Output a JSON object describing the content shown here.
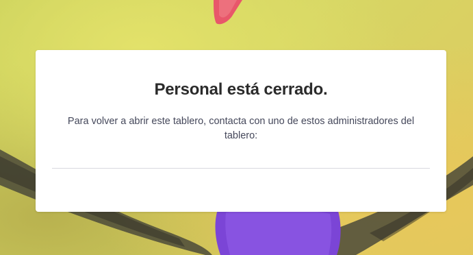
{
  "board_closed": {
    "title": "Personal está cerrado.",
    "message": "Para volver a abrir este tablero, contacta con uno de estos administradores del tablero:"
  },
  "background": {
    "image": "hummingbird-photo",
    "colors": {
      "backdrop": "#d6d664",
      "bird_throat": "#7b45d6",
      "beak": "#e8576a"
    }
  }
}
